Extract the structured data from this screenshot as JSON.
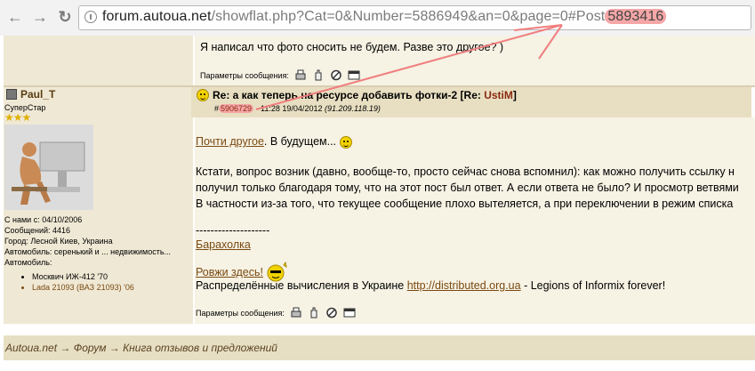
{
  "browser": {
    "url_domain": "forum.autoua.net",
    "url_path": "/showflat.php?Cat=0&Number=5886949&an=0&page=0#Post",
    "url_anchor": "5893416"
  },
  "top_post": {
    "text": "Я написал что фото сносить не будем. Разве это другое? )",
    "params_label": "Параметры сообщения:"
  },
  "author": {
    "name": "Paul_T",
    "rank": "СуперСтар",
    "stars": "★★★",
    "joined": "С нами с: 04/10/2006",
    "posts": "Сообщений: 4416",
    "city": "Город: Лесной Киев, Украина",
    "car_note": "Автомобиль: серенький и ... недвижимость...",
    "car_label": "Автомобиль:",
    "cars": [
      "Москвич ИЖ-412 '70",
      "Lada 21093 (ВАЗ 21093) '06"
    ]
  },
  "post": {
    "title_prefix": "Re: а как теперь на ресурсе добавить фотки-2 [",
    "title_prefix2": "Re: ",
    "title_user": "UstiM",
    "title_suffix": "]",
    "post_hash": "#",
    "post_number": "5906729",
    "post_meta": " - 11:28 19/04/2012 ",
    "post_ip": "(91.209.118.19)",
    "body_link": "Почти другое",
    "body_after_link": ". В будущем...",
    "para1": "Кстати, вопрос возник (давно, вообще-то, просто сейчас снова вспомнил): как можно получить ссылку н",
    "para2": "получил только благодаря тому, что на этот пост был ответ. А если ответа не было? И просмотр ветвями",
    "para3": "В частности из-за того, что текущее сообщение плохо вытеляется, а при переключении в режим списка",
    "divider": "--------------------",
    "sig_link1": "Барахолка",
    "sig_link2": "Ровжи здесь!",
    "sig_text_before": "Распределённые вычисления в Украине ",
    "sig_url": "http://distributed.org.ua",
    "sig_text_after": " - Legions of Informix forever!",
    "params_label": "Параметры сообщения:"
  },
  "footer": {
    "breadcrumb": "Autoua.net → Форум → Книга отзывов и предложений"
  },
  "colors": {
    "highlight": "#f5a6a6",
    "arrow": "#f07f7f"
  }
}
